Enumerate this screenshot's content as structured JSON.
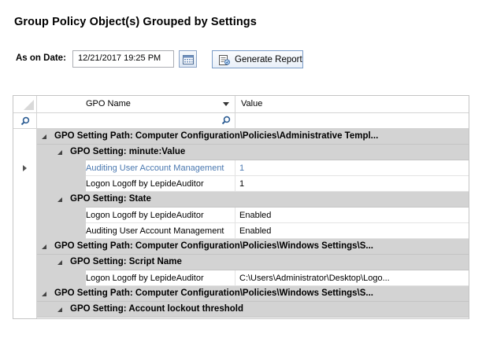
{
  "page": {
    "title": "Group Policy Object(s) Grouped by Settings"
  },
  "toolbar": {
    "date_label": "As on Date:",
    "date_value": "12/21/2017 19:25 PM",
    "generate_label": "Generate Report"
  },
  "grid": {
    "columns": {
      "gpo_name": "GPO Name",
      "value": "Value"
    },
    "rows": [
      {
        "kind": "path",
        "text": "GPO Setting Path: Computer Configuration\\Policies\\Administrative Templ..."
      },
      {
        "kind": "setting",
        "text": "GPO Setting: minute:Value"
      },
      {
        "kind": "data",
        "gpo": "Auditing User Account Management",
        "value": "1",
        "selected": true
      },
      {
        "kind": "data",
        "gpo": "Logon Logoff by LepideAuditor",
        "value": "1"
      },
      {
        "kind": "setting",
        "text": "GPO Setting: State"
      },
      {
        "kind": "data",
        "gpo": "Logon Logoff by LepideAuditor",
        "value": "Enabled"
      },
      {
        "kind": "data",
        "gpo": "Auditing User Account Management",
        "value": "Enabled"
      },
      {
        "kind": "path",
        "text": "GPO Setting Path: Computer Configuration\\Policies\\Windows Settings\\S..."
      },
      {
        "kind": "setting",
        "text": "GPO Setting: Script Name"
      },
      {
        "kind": "data",
        "gpo": "Logon Logoff by LepideAuditor",
        "value": "C:\\Users\\Administrator\\Desktop\\Logo..."
      },
      {
        "kind": "path",
        "text": "GPO Setting Path: Computer Configuration\\Policies\\Windows Settings\\S..."
      },
      {
        "kind": "setting",
        "text": "GPO Setting: Account lockout threshold"
      }
    ]
  },
  "colors": {
    "group_bg": "#d3d3d3",
    "selected_text": "#4a78b0",
    "button_border": "#7a9cc7"
  }
}
